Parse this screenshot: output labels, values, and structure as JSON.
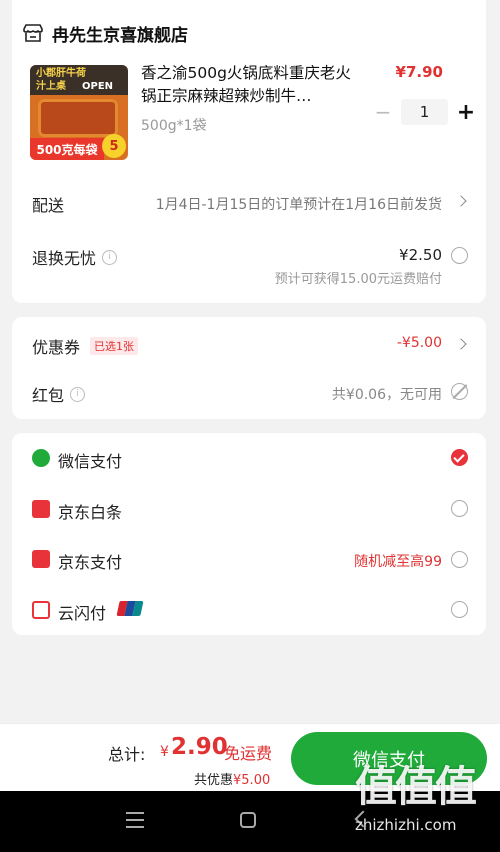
{
  "store": {
    "name": "冉先生京喜旗舰店",
    "icon": "store-icon"
  },
  "product": {
    "title": "香之渝500g火锅底料重庆老火锅正宗麻辣超辣炒制牛…",
    "spec": "500g*1袋",
    "price": "¥7.90",
    "quantity": "1",
    "minus": "−",
    "plus": "+",
    "thumb": {
      "top_text_1": "小郡肝牛荷",
      "top_text_2": "汁上桌",
      "top_text_3": "OPEN",
      "bottom_text": "500克每袋",
      "badge": "5"
    }
  },
  "delivery": {
    "label": "配送",
    "value": "1月4日-1月15日的订单预计在1月16日前发货"
  },
  "return": {
    "label": "退换无忧",
    "price": "¥2.50",
    "note": "预计可获得15.00元运费赔付"
  },
  "coupon": {
    "label": "优惠券",
    "tag": "已选1张",
    "value": "-¥5.00"
  },
  "red_packet": {
    "label": "红包",
    "value": "共¥0.06，无可用"
  },
  "payments": [
    {
      "label": "微信支付",
      "icon": "wechat-pay-icon",
      "color": "#1faa39",
      "selected": true,
      "promo": ""
    },
    {
      "label": "京东白条",
      "icon": "jd-baitiao-icon",
      "color": "#e8333b",
      "selected": false,
      "promo": ""
    },
    {
      "label": "京东支付",
      "icon": "jd-pay-icon",
      "color": "#e8333b",
      "selected": false,
      "promo": "随机减至高99"
    },
    {
      "label": "云闪付",
      "icon": "cloud-quickpass-icon",
      "color": "#e8333b",
      "selected": false,
      "promo": ""
    }
  ],
  "footer": {
    "total_label": "总计:",
    "currency": "¥",
    "total": "2.90",
    "free_shipping": "免运费",
    "saved_label": "共优惠",
    "saved_amount": "¥5.00",
    "pay_button": "微信支付"
  },
  "watermark": {
    "logo": "值值值",
    "url": "zhizhizhi.com"
  },
  "colors": {
    "accent": "#e03232",
    "pay_green": "#1faa39",
    "bg": "#f2f2f2"
  }
}
